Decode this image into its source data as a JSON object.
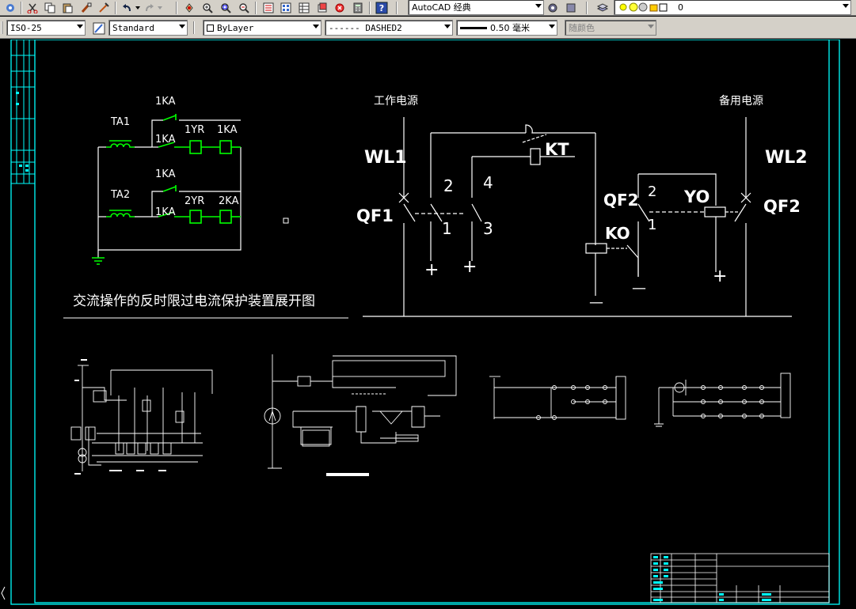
{
  "toolbar": {
    "workspace": "AutoCAD 经典",
    "layer": "0"
  },
  "properties": {
    "dimstyle": "ISO-25",
    "textstyle": "Standard",
    "color": "ByLayer",
    "linetype": "------ DASHED2",
    "lineweight": "0.50 毫米",
    "plotstyle": "随颜色"
  },
  "drawing": {
    "labels": {
      "ka1_top": "1KA",
      "ta1": "TA1",
      "yr1": "1YR",
      "ka1_right": "1KA",
      "ka1_mid": "1KA",
      "ka1_2top": "1KA",
      "ta2": "TA2",
      "ka1_2mid": "1KA",
      "yr2": "2YR",
      "ka2": "2KA",
      "title": "交流操作的反时限过电流保护装置展开图",
      "work_power": "工作电源",
      "backup_power": "备用电源",
      "wl1": "WL1",
      "wl2": "WL2",
      "qf1": "QF1",
      "qf2_left": "QF2",
      "qf2_right": "QF2",
      "kt": "KT",
      "yo": "YO",
      "ko": "KO",
      "n2a": "2",
      "n4": "4",
      "n1a": "1",
      "n3": "3",
      "n2b": "2",
      "n1b": "1",
      "plus1": "+",
      "plus2": "+",
      "plus3": "+",
      "minus1": "—",
      "minus2": "—"
    }
  }
}
